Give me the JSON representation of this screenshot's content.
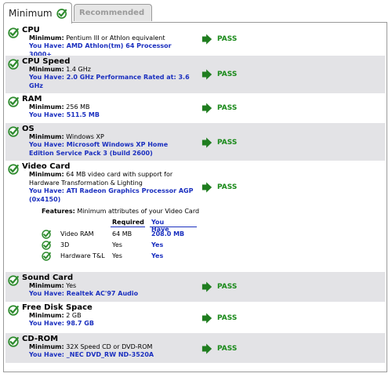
{
  "tabs": {
    "minimum": "Minimum",
    "recommended": "Recommended"
  },
  "labels": {
    "min": "Minimum:",
    "have": "You Have:",
    "pass": "PASS"
  },
  "colors": {
    "pass_green": "#1a8a1a",
    "have_blue": "#1a2fbf",
    "row_shade": "#e3e3e6",
    "check_green": "#2e8b2e",
    "fail_red": "#d92020"
  },
  "items": [
    {
      "title": "CPU",
      "minimum": "Pentium III or Athlon equivalent",
      "have": "AMD Athlon(tm) 64 Processor 3000+"
    },
    {
      "title": "CPU Speed",
      "minimum": "1.4 GHz",
      "have": "2.0 GHz Performance Rated at: 3.6 GHz"
    },
    {
      "title": "RAM",
      "minimum": "256 MB",
      "have": "511.5 MB"
    },
    {
      "title": "OS",
      "minimum": "Windows XP",
      "have": "Microsoft Windows XP Home Edition Service Pack 3 (build 2600)"
    },
    {
      "title": "Video Card",
      "minimum": "64 MB video card with support for Hardware Transformation & Lighting",
      "have": "ATI Radeon Graphics Processor AGP (0x4150)"
    },
    {
      "title": "Sound Card",
      "minimum": "Yes",
      "have": "Realtek AC'97 Audio"
    },
    {
      "title": "Free Disk Space",
      "minimum": "2 GB",
      "have": "98.7 GB"
    },
    {
      "title": "CD-ROM",
      "minimum": "32X Speed CD or DVD-ROM",
      "have": "_NEC DVD_RW ND-3520A"
    }
  ],
  "video_features": {
    "heading": "Features:",
    "description": "Minimum attributes of your Video Card",
    "col_required": "Required",
    "col_have": "You Have",
    "rows": [
      {
        "name": "Video RAM",
        "required": "64 MB",
        "have": "208.0 MB"
      },
      {
        "name": "3D",
        "required": "Yes",
        "have": "Yes"
      },
      {
        "name": "Hardware T&L",
        "required": "Yes",
        "have": "Yes"
      }
    ]
  }
}
